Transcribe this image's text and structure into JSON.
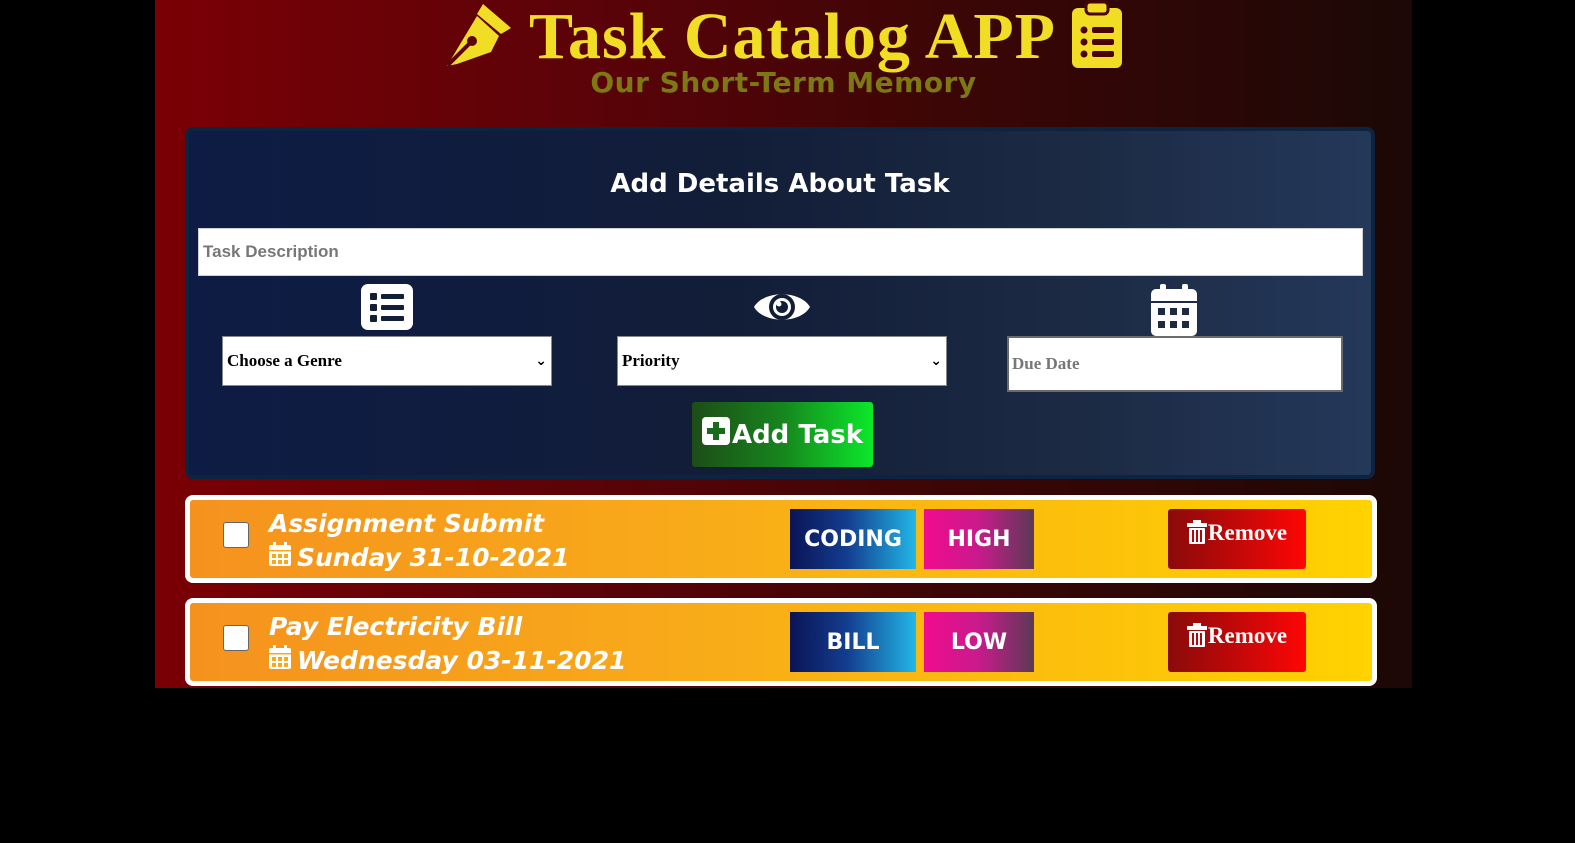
{
  "header": {
    "title": "Task Catalog APP",
    "subtitle": "Our Short-Term Memory",
    "icons": [
      "pen-nib-icon",
      "clipboard-list-icon"
    ],
    "title_color": "#f2dd25"
  },
  "form": {
    "title": "Add Details About Task",
    "description_placeholder": "Task Description",
    "genre_select": {
      "selected": "Choose a Genre",
      "icon": "list-icon"
    },
    "priority_select": {
      "selected": "Priority",
      "icon": "eye-icon"
    },
    "due_date": {
      "placeholder": "Due Date",
      "icon": "calendar-icon"
    },
    "add_button": {
      "label": "Add Task",
      "icon": "plus-square-icon"
    }
  },
  "tasks": [
    {
      "name": "Assignment Submit",
      "date": "Sunday 31-10-2021",
      "genre": "CODING",
      "priority": "HIGH",
      "remove_label": "Remove",
      "checked": false
    },
    {
      "name": "Pay Electricity Bill",
      "date": "Wednesday 03-11-2021",
      "genre": "BILL",
      "priority": "LOW",
      "remove_label": "Remove",
      "checked": false
    }
  ]
}
